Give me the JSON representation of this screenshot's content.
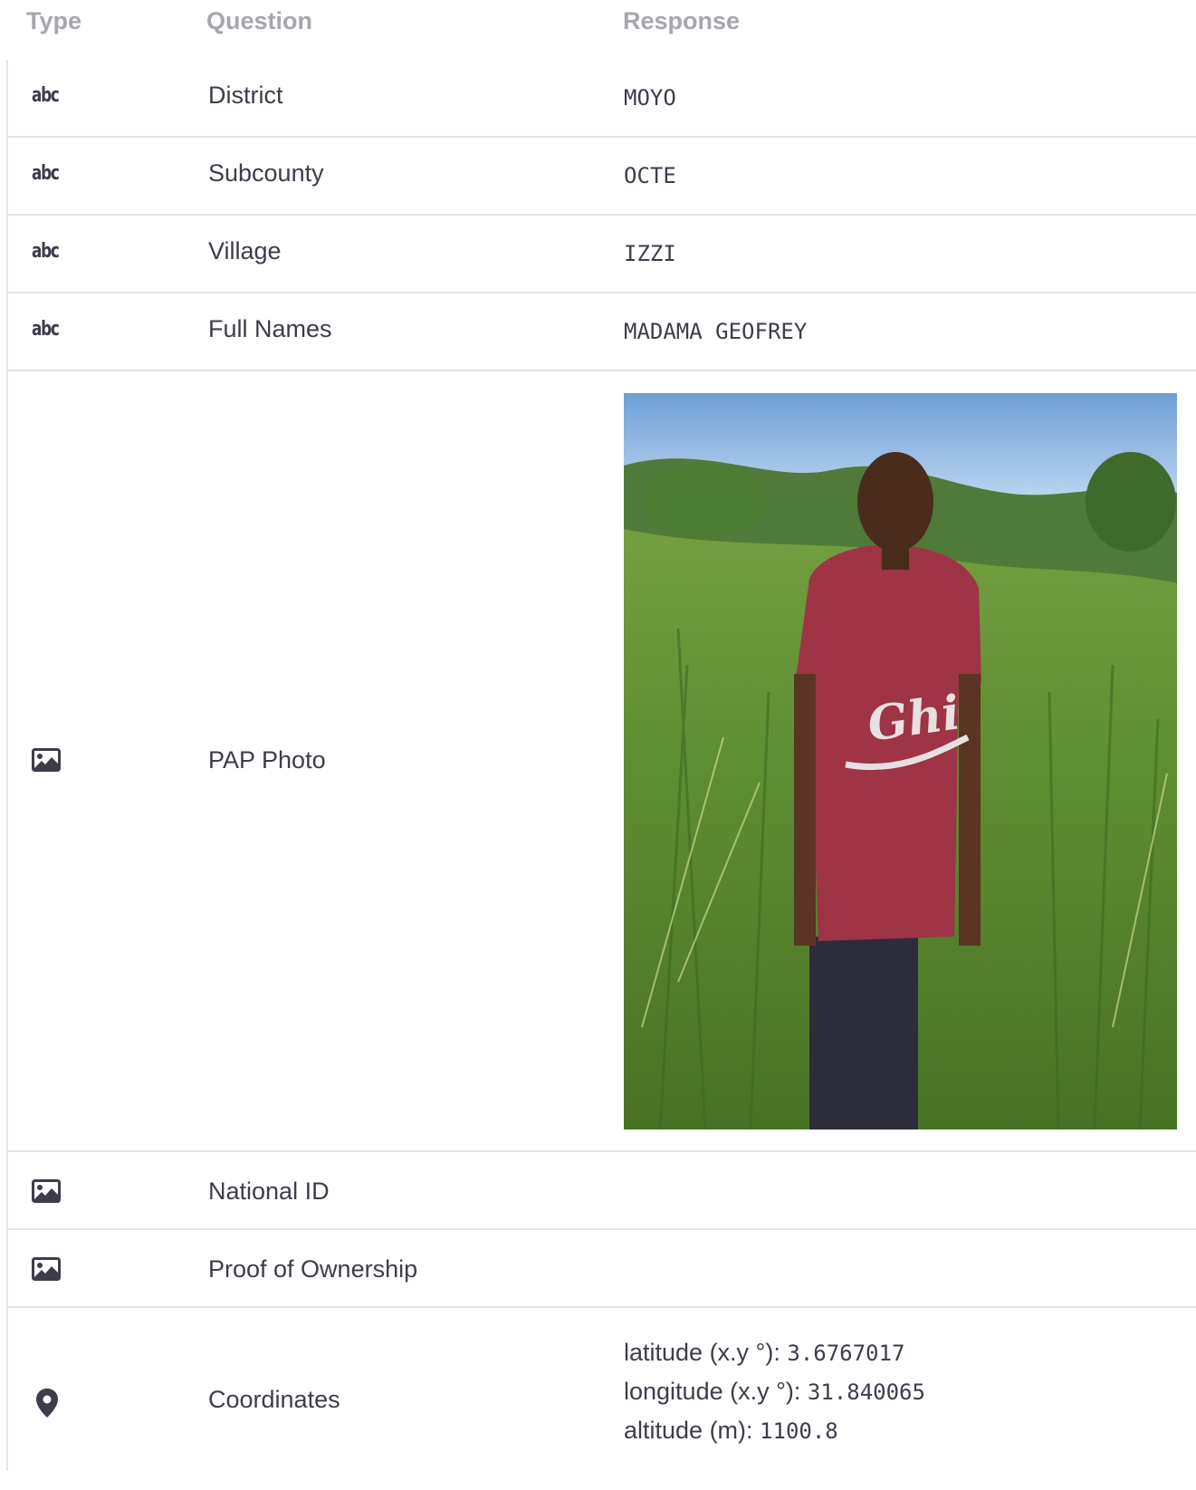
{
  "header": {
    "type": "Type",
    "question": "Question",
    "response": "Response"
  },
  "rows": [
    {
      "icon": "text-type-icon",
      "type_label": "abc",
      "question": "District",
      "response": "MOYO"
    },
    {
      "icon": "text-type-icon",
      "type_label": "abc",
      "question": "Subcounty",
      "response": "OCTE"
    },
    {
      "icon": "text-type-icon",
      "type_label": "abc",
      "question": "Village",
      "response": "IZZI"
    },
    {
      "icon": "text-type-icon",
      "type_label": "abc",
      "question": "Full Names",
      "response": "MADAMA GEOFREY"
    },
    {
      "icon": "image-icon",
      "question": "PAP Photo",
      "response": ""
    },
    {
      "icon": "image-icon",
      "question": "National ID",
      "response": ""
    },
    {
      "icon": "image-icon",
      "question": "Proof of Ownership",
      "response": ""
    },
    {
      "icon": "map-pin-icon",
      "question": "Coordinates",
      "response": ""
    }
  ],
  "coordinates": {
    "latitude_label": "latitude (x.y °): ",
    "latitude": "3.6767017",
    "longitude_label": "longitude (x.y °): ",
    "longitude": "31.840065",
    "altitude_label": "altitude (m): ",
    "altitude": "1100.8"
  },
  "colors": {
    "text": "#3d3d4a",
    "header": "#a6a6ad",
    "divider": "#e4e4e8"
  }
}
